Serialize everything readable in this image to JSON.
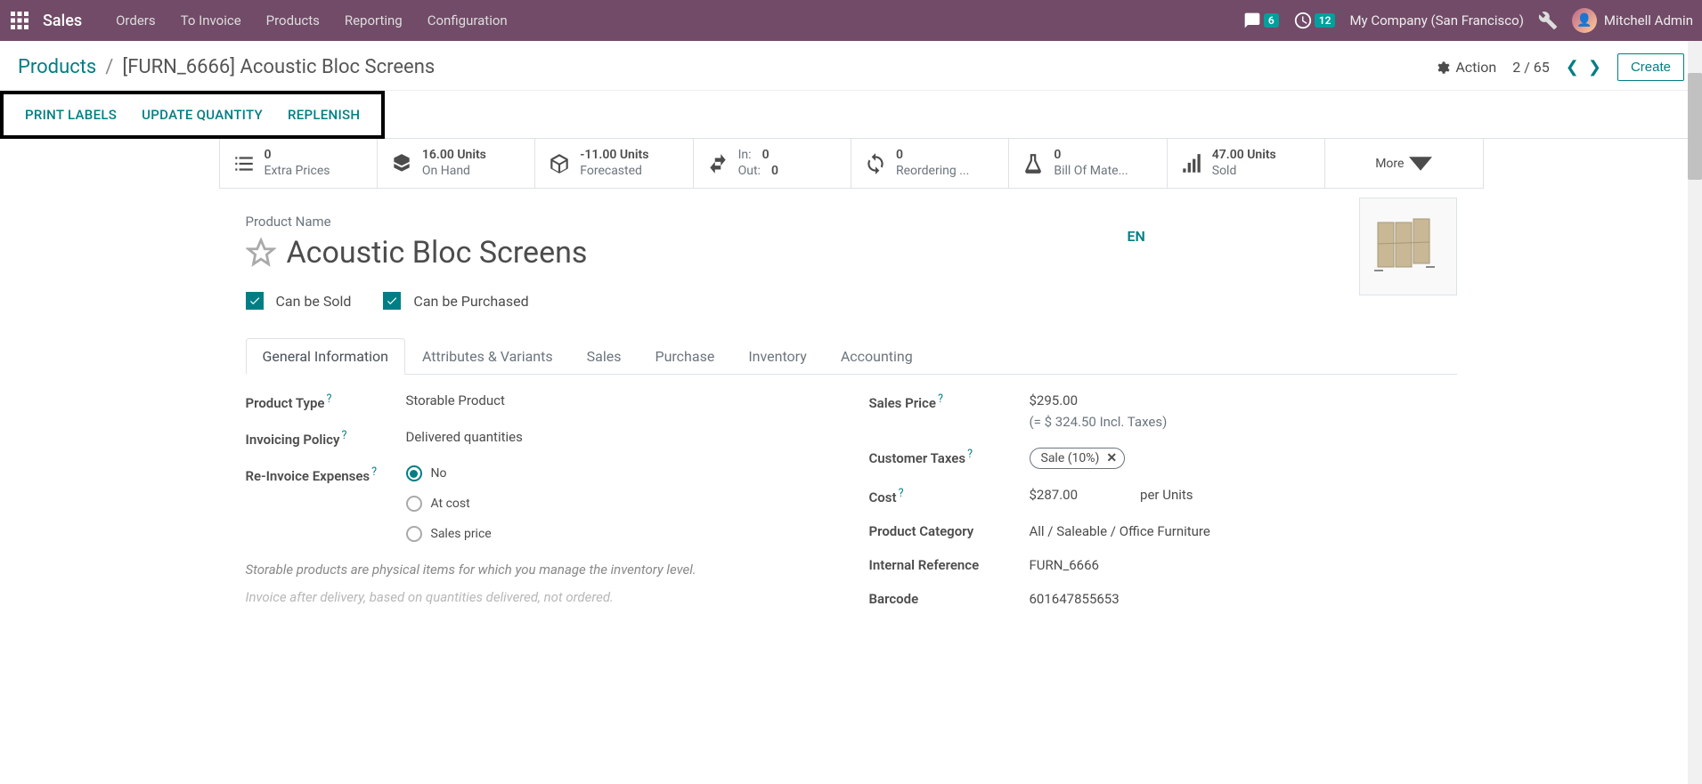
{
  "nav": {
    "brand": "Sales",
    "items": [
      "Orders",
      "To Invoice",
      "Products",
      "Reporting",
      "Configuration"
    ],
    "msg_badge": "6",
    "clock_badge": "12",
    "company": "My Company (San Francisco)",
    "user": "Mitchell Admin"
  },
  "crumb": {
    "root": "Products",
    "current": "[FURN_6666] Acoustic Bloc Screens",
    "action": "Action",
    "page_cur": "2",
    "page_total": "65",
    "create": "Create"
  },
  "actions": {
    "print": "PRINT LABELS",
    "update": "UPDATE QUANTITY",
    "replenish": "REPLENISH"
  },
  "stats": {
    "extra": {
      "val": "0",
      "lbl": "Extra Prices"
    },
    "onhand": {
      "val": "16.00 Units",
      "lbl": "On Hand"
    },
    "forecast": {
      "val": "-11.00 Units",
      "lbl": "Forecasted"
    },
    "in": {
      "lbl": "In:",
      "val": "0"
    },
    "out": {
      "lbl": "Out:",
      "val": "0"
    },
    "reorder": {
      "val": "0",
      "lbl": "Reordering ..."
    },
    "bom": {
      "val": "0",
      "lbl": "Bill Of Mate..."
    },
    "sold": {
      "val": "47.00 Units",
      "lbl": "Sold"
    },
    "more": "More"
  },
  "product": {
    "name_lbl": "Product Name",
    "name": "Acoustic Bloc Screens",
    "lang": "EN",
    "can_sold": "Can be Sold",
    "can_purch": "Can be Purchased"
  },
  "tabs": [
    "General Information",
    "Attributes & Variants",
    "Sales",
    "Purchase",
    "Inventory",
    "Accounting"
  ],
  "form": {
    "ptype_lbl": "Product Type",
    "ptype": "Storable Product",
    "inv_lbl": "Invoicing Policy",
    "inv": "Delivered quantities",
    "reinv_lbl": "Re-Invoice Expenses",
    "r1": "No",
    "r2": "At cost",
    "r3": "Sales price",
    "note1": "Storable products are physical items for which you manage the inventory level.",
    "note2": "Invoice after delivery, based on quantities delivered, not ordered.",
    "sprice_lbl": "Sales Price",
    "sprice": "$295.00",
    "sprice_tax": "(= $ 324.50 Incl. Taxes)",
    "ctax_lbl": "Customer Taxes",
    "ctax_tag": "Sale (10%)",
    "cost_lbl": "Cost",
    "cost": "$287.00",
    "cost_per": "per Units",
    "cat_lbl": "Product Category",
    "cat": "All / Saleable / Office Furniture",
    "iref_lbl": "Internal Reference",
    "iref": "FURN_6666",
    "bar_lbl": "Barcode",
    "bar": "601647855653"
  }
}
